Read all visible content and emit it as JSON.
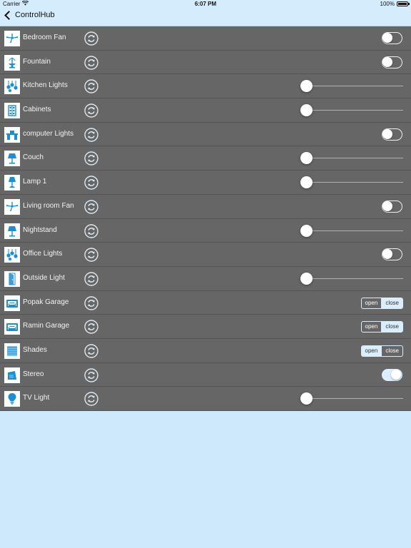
{
  "status_bar": {
    "carrier": "Carrier",
    "time": "6:07 PM",
    "battery": "100%"
  },
  "nav": {
    "back_label": "ControlHub"
  },
  "colors": {
    "background": "#cde9fb",
    "row_background": "#666666",
    "accent": "#dbeefb",
    "icon_blue": "#1a8fd6"
  },
  "devices": [
    {
      "name": "Bedroom Fan",
      "icon": "ceiling-fan-icon",
      "control": "toggle",
      "on": false
    },
    {
      "name": "Fountain",
      "icon": "fountain-icon",
      "control": "toggle",
      "on": false
    },
    {
      "name": "Kitchen Lights",
      "icon": "pendant-lights-icon",
      "control": "slider",
      "level": 0
    },
    {
      "name": "Cabinets",
      "icon": "cabinet-icon",
      "control": "slider",
      "level": 0
    },
    {
      "name": "computer Lights",
      "icon": "desk-icon",
      "control": "toggle",
      "on": false
    },
    {
      "name": "Couch",
      "icon": "floor-lamp-icon",
      "control": "slider",
      "level": 0
    },
    {
      "name": "Lamp 1",
      "icon": "table-lamp-icon",
      "control": "slider",
      "level": 0
    },
    {
      "name": "Living room Fan",
      "icon": "ceiling-fan-icon",
      "control": "toggle",
      "on": false
    },
    {
      "name": "Nightstand",
      "icon": "floor-lamp-icon",
      "control": "slider",
      "level": 0
    },
    {
      "name": "Office Lights",
      "icon": "pendant-lights-icon",
      "control": "toggle",
      "on": false
    },
    {
      "name": "Outside Light",
      "icon": "door-icon",
      "control": "slider",
      "level": 0
    },
    {
      "name": "Popak Garage",
      "icon": "garage-icon",
      "control": "segment",
      "options": [
        "open",
        "close"
      ],
      "selected": "close"
    },
    {
      "name": "Ramin Garage",
      "icon": "garage-icon",
      "control": "segment",
      "options": [
        "open",
        "close"
      ],
      "selected": "close"
    },
    {
      "name": "Shades",
      "icon": "shades-icon",
      "control": "segment",
      "options": [
        "open",
        "close"
      ],
      "selected": "open"
    },
    {
      "name": "Stereo",
      "icon": "speaker-icon",
      "control": "toggle",
      "on": true
    },
    {
      "name": "TV Light",
      "icon": "bulb-icon",
      "control": "slider",
      "level": 0
    }
  ]
}
